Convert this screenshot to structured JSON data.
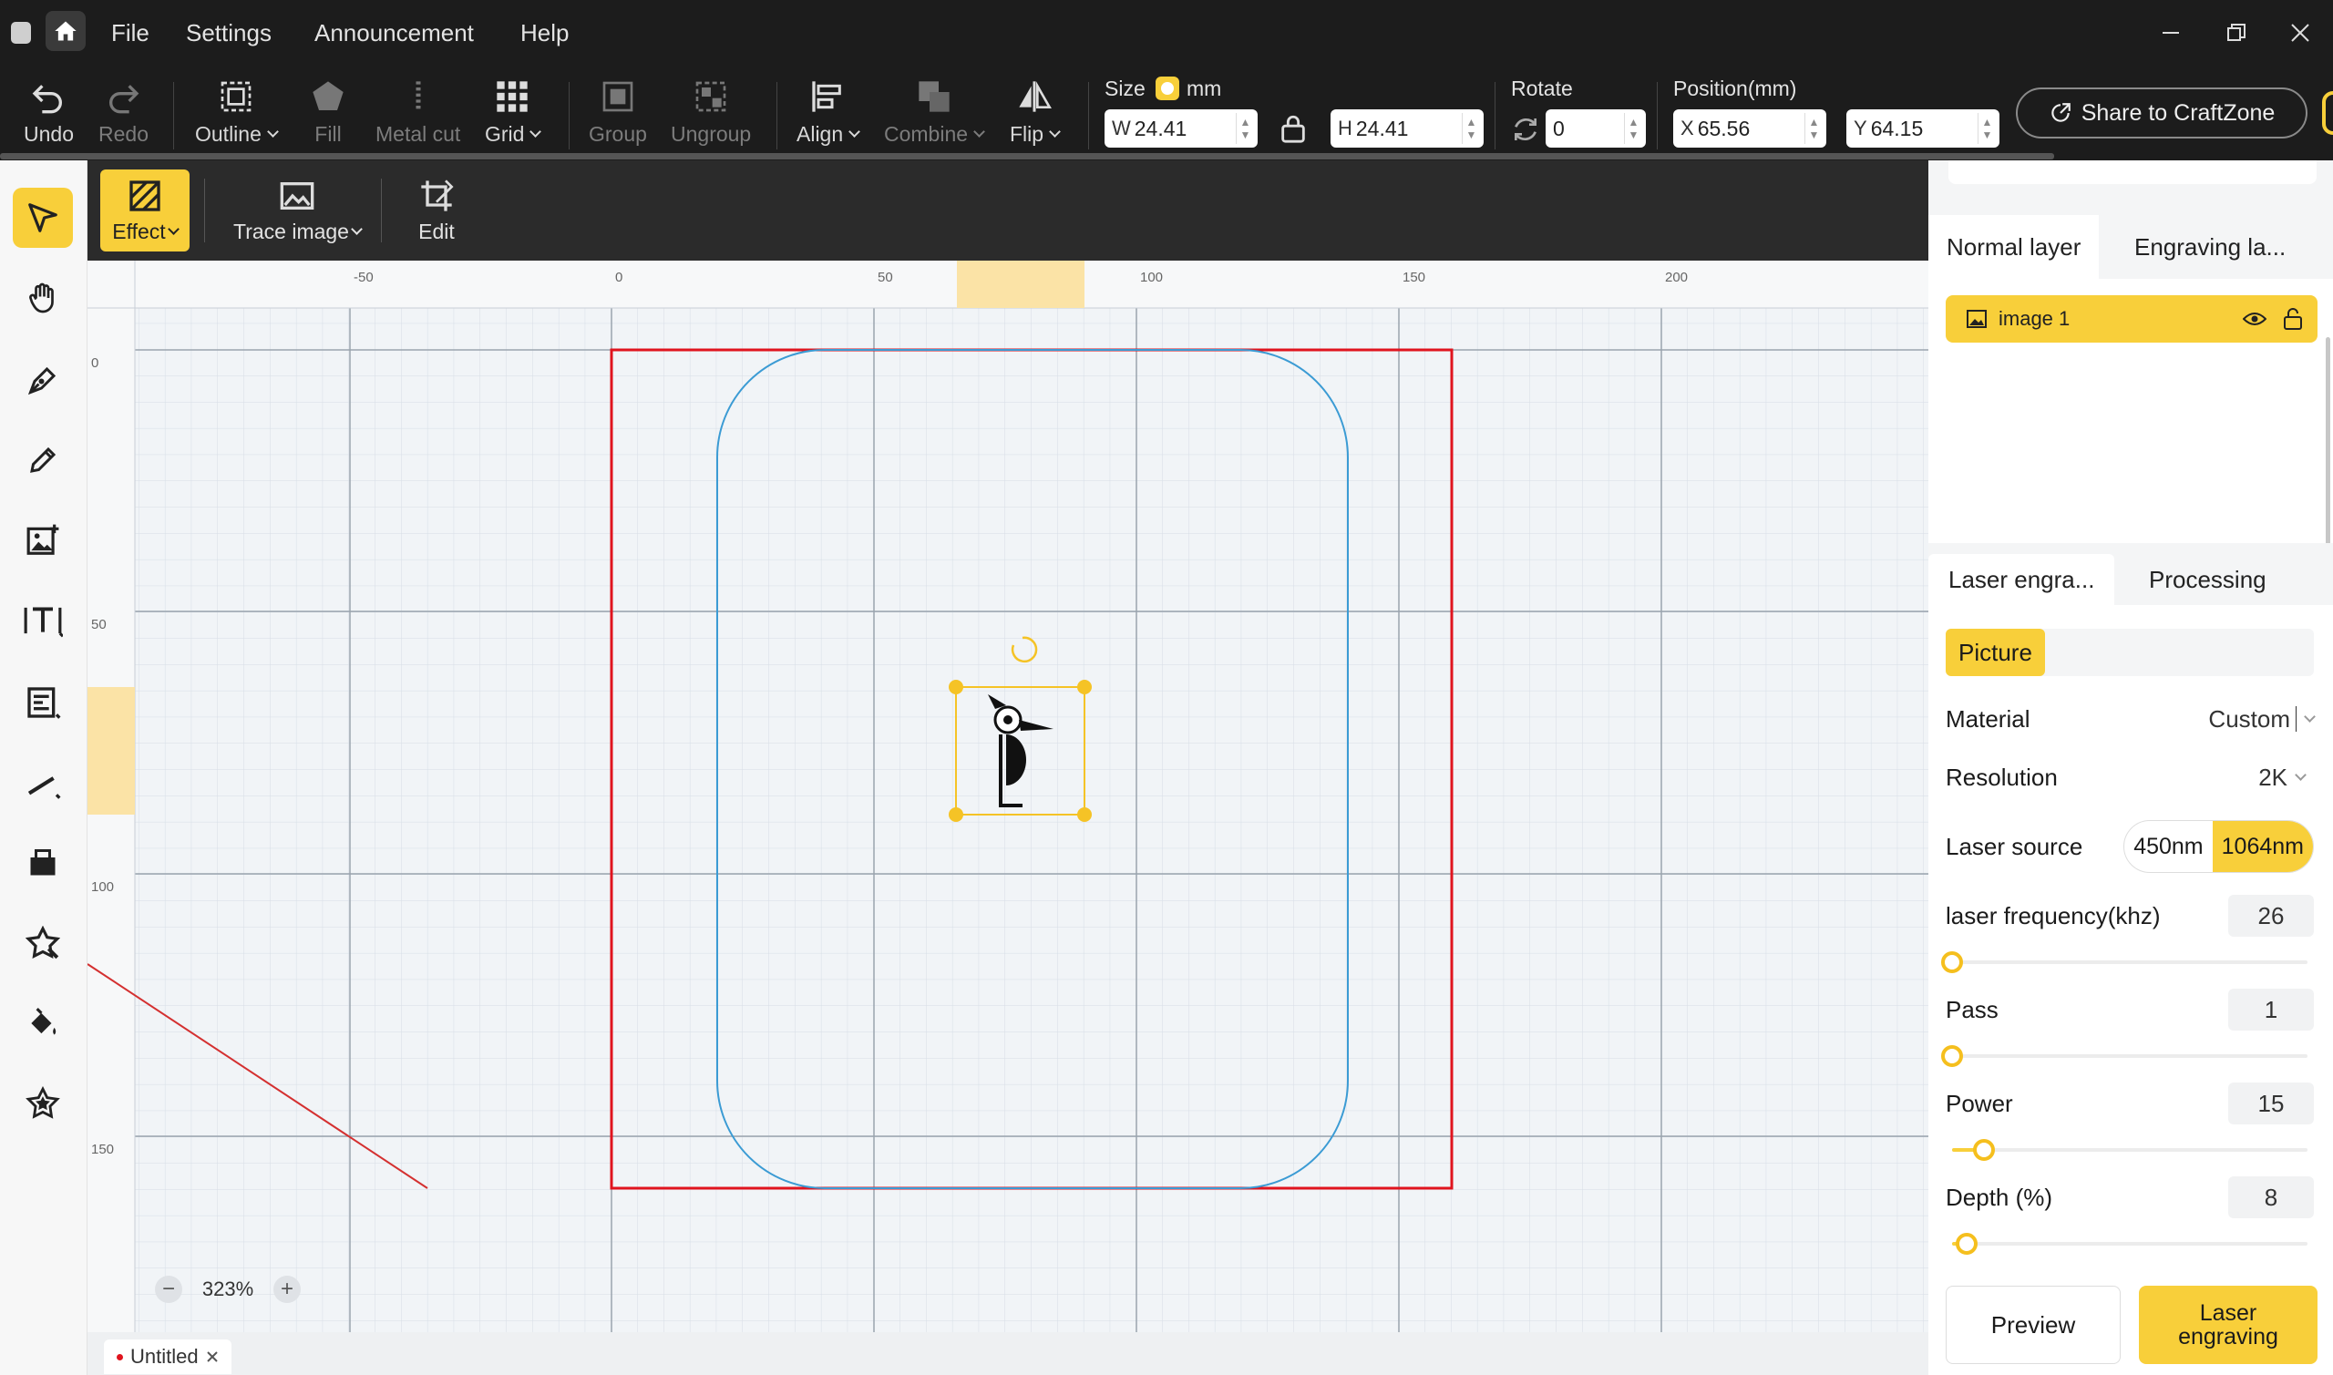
{
  "menu": {
    "file": "File",
    "settings": "Settings",
    "announcement": "Announcement",
    "help": "Help"
  },
  "toolbar": {
    "undo": "Undo",
    "redo": "Redo",
    "outline": "Outline",
    "fill": "Fill",
    "metal_cut": "Metal cut",
    "grid": "Grid",
    "group": "Group",
    "ungroup": "Ungroup",
    "align": "Align",
    "combine": "Combine",
    "flip": "Flip",
    "size_label": "Size",
    "unit": "mm",
    "w_prefix": "W",
    "w_value": "24.41",
    "h_prefix": "H",
    "h_value": "24.41",
    "rotate_label": "Rotate",
    "rotate_value": "0",
    "position_label": "Position(mm)",
    "x_prefix": "X",
    "x_value": "65.56",
    "y_prefix": "Y",
    "y_value": "64.15",
    "share": "Share to CraftZone"
  },
  "subbar": {
    "effect": "Effect",
    "trace_image": "Trace image",
    "edit": "Edit"
  },
  "ruler": {
    "top_ticks": [
      "-50",
      "0",
      "50",
      "100",
      "150",
      "200"
    ],
    "left_ticks": [
      "0",
      "50",
      "100",
      "150"
    ]
  },
  "zoom": {
    "value": "323%",
    "minus": "−",
    "plus": "+"
  },
  "document_tab": {
    "name": "Untitled"
  },
  "layers": {
    "tabs": [
      "Normal layer",
      "Engraving la..."
    ],
    "items": [
      {
        "name": "image 1"
      }
    ]
  },
  "settings": {
    "tabs": [
      "Laser engra...",
      "Processing"
    ],
    "mode": "Picture",
    "material_label": "Material",
    "material_value": "Custom",
    "resolution_label": "Resolution",
    "resolution_value": "2K",
    "laser_source_label": "Laser source",
    "laser_source_options": [
      "450nm",
      "1064nm"
    ],
    "laser_source_selected": "1064nm",
    "frequency_label": "laser frequency(khz)",
    "frequency_value": "26",
    "frequency_level": 0.0,
    "pass_label": "Pass",
    "pass_value": "1",
    "pass_level": 0.0,
    "power_label": "Power",
    "power_value": "15",
    "power_level": 0.09,
    "depth_label": "Depth (%)",
    "depth_value": "8",
    "depth_level": 0.04,
    "preview": "Preview",
    "engrave": "Laser engraving"
  },
  "colors": {
    "accent": "#f8cf3a",
    "canvas_frame": "#e0141e",
    "outline_shape": "#3b9bd4"
  }
}
